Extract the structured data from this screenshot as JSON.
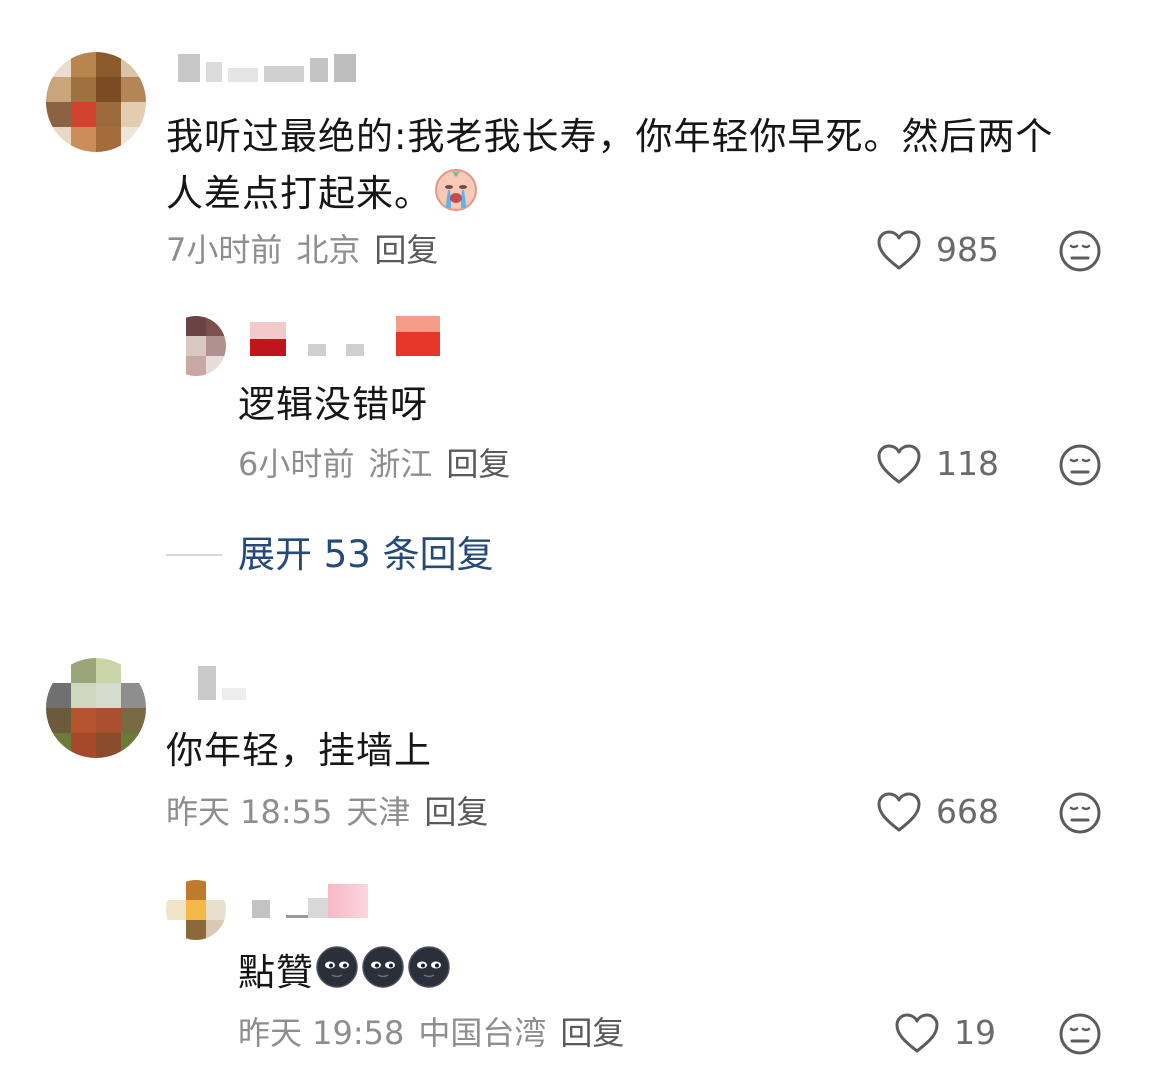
{
  "comments": [
    {
      "text": "我听过最绝的:我老我长寿，你年轻你早死。然后两个\n人差点打起来。",
      "time": "7小时前",
      "location": "北京",
      "reply_label": "回复",
      "likes": "985",
      "replies": [
        {
          "text": "逻辑没错呀",
          "time": "6小时前",
          "location": "浙江",
          "reply_label": "回复",
          "likes": "118"
        }
      ],
      "expand_label": "展开 53 条回复"
    },
    {
      "text": "你年轻，挂墙上",
      "time": "昨天 18:55",
      "location": "天津",
      "reply_label": "回复",
      "likes": "668",
      "replies": [
        {
          "text": "點贊",
          "time": "昨天 19:58",
          "location": "中国台湾",
          "reply_label": "回复",
          "likes": "19"
        }
      ]
    }
  ],
  "icons": {
    "like": "heart-outline-icon",
    "dislike": "neutral-face-icon",
    "emoji_cry": "crying-baby-emoji",
    "emoji_dark": "dark-moon-face-emoji"
  },
  "colors": {
    "text": "#161616",
    "meta": "#8e8e8e",
    "link": "#254a7a"
  }
}
